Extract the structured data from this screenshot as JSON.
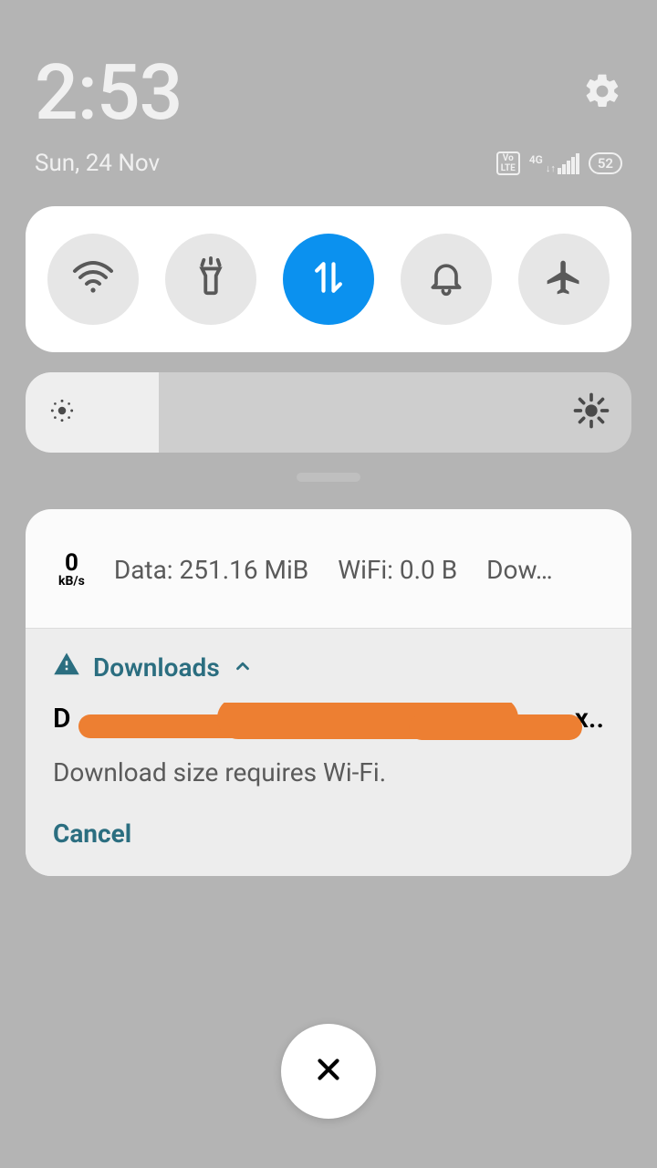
{
  "status": {
    "time": "2:53",
    "date": "Sun, 24 Nov",
    "volte_label": "Vo\nLTE",
    "network_label": "4G",
    "battery_percent": "52"
  },
  "toggles": {
    "wifi_active": false,
    "flashlight_active": false,
    "data_active": true,
    "dnd_active": false,
    "airplane_active": false
  },
  "notification": {
    "speed_value": "0",
    "speed_unit": "kB/s",
    "data_label": "Data: 251.16 MiB",
    "wifi_label": "WiFi: 0.0 B",
    "third_label": "Dow…",
    "section_title": "Downloads",
    "file_prefix": "D",
    "file_suffix": ".x..",
    "subtext": "Download size requires Wi-Fi.",
    "cancel_label": "Cancel"
  }
}
